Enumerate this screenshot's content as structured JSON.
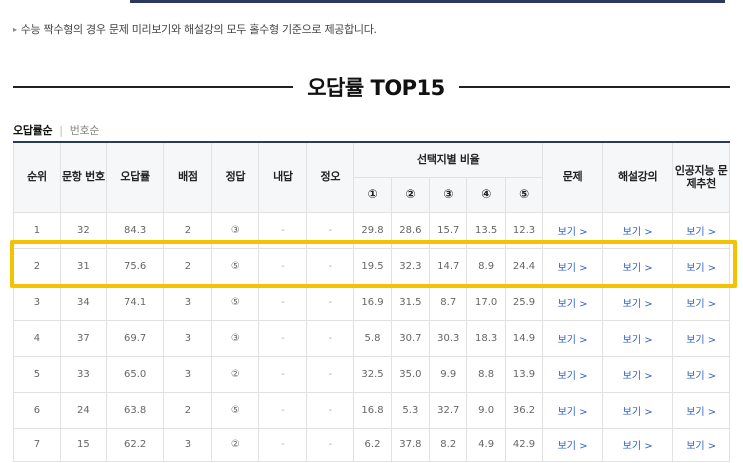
{
  "notice": "수능 짝수형의 경우 문제 미리보기와 해설강의 모두 홀수형 기준으로 제공합니다.",
  "section_title": "오답률 TOP15",
  "sort_tabs": {
    "active": "오답률순",
    "inactive": "번호순"
  },
  "table": {
    "headers": {
      "rank": "순위",
      "question_no": "문항 번호",
      "wrong_rate": "오답률",
      "points": "배점",
      "answer": "정답",
      "my_answer": "내답",
      "correct_wrong": "정오",
      "choice_ratio": "선택지별 비율",
      "choices": [
        "①",
        "②",
        "③",
        "④",
        "⑤"
      ],
      "problem": "문제",
      "lecture": "해설강의",
      "ai_recommend": "인공지능 문제추천"
    },
    "rows": [
      {
        "rank": "1",
        "no": "32",
        "rate": "84.3",
        "points": "2",
        "answer": "③",
        "mine": "-",
        "ox": "-",
        "c1": "29.8",
        "c2": "28.6",
        "c3": "15.7",
        "c4": "13.5",
        "c5": "12.3",
        "view1": "보기 >",
        "view2": "보기 >",
        "view3": "보기 >"
      },
      {
        "rank": "2",
        "no": "31",
        "rate": "75.6",
        "points": "2",
        "answer": "⑤",
        "mine": "-",
        "ox": "-",
        "c1": "19.5",
        "c2": "32.3",
        "c3": "14.7",
        "c4": "8.9",
        "c5": "24.4",
        "view1": "보기 >",
        "view2": "보기 >",
        "view3": "보기 >"
      },
      {
        "rank": "3",
        "no": "34",
        "rate": "74.1",
        "points": "3",
        "answer": "⑤",
        "mine": "-",
        "ox": "-",
        "c1": "16.9",
        "c2": "31.5",
        "c3": "8.7",
        "c4": "17.0",
        "c5": "25.9",
        "view1": "보기 >",
        "view2": "보기 >",
        "view3": "보기 >"
      },
      {
        "rank": "4",
        "no": "37",
        "rate": "69.7",
        "points": "3",
        "answer": "③",
        "mine": "-",
        "ox": "-",
        "c1": "5.8",
        "c2": "30.7",
        "c3": "30.3",
        "c4": "18.3",
        "c5": "14.9",
        "view1": "보기 >",
        "view2": "보기 >",
        "view3": "보기 >"
      },
      {
        "rank": "5",
        "no": "33",
        "rate": "65.0",
        "points": "3",
        "answer": "②",
        "mine": "-",
        "ox": "-",
        "c1": "32.5",
        "c2": "35.0",
        "c3": "9.9",
        "c4": "8.8",
        "c5": "13.9",
        "view1": "보기 >",
        "view2": "보기 >",
        "view3": "보기 >"
      },
      {
        "rank": "6",
        "no": "24",
        "rate": "63.8",
        "points": "2",
        "answer": "⑤",
        "mine": "-",
        "ox": "-",
        "c1": "16.8",
        "c2": "5.3",
        "c3": "32.7",
        "c4": "9.0",
        "c5": "36.2",
        "view1": "보기 >",
        "view2": "보기 >",
        "view3": "보기 >"
      },
      {
        "rank": "7",
        "no": "15",
        "rate": "62.2",
        "points": "3",
        "answer": "②",
        "mine": "-",
        "ox": "-",
        "c1": "6.2",
        "c2": "37.8",
        "c3": "8.2",
        "c4": "4.9",
        "c5": "42.9",
        "view1": "보기 >",
        "view2": "보기 >",
        "view3": "보기 >"
      }
    ]
  },
  "colors": {
    "accent_line": "#2b3a5c",
    "link": "#2e62c9",
    "highlight": "#f5c200"
  }
}
